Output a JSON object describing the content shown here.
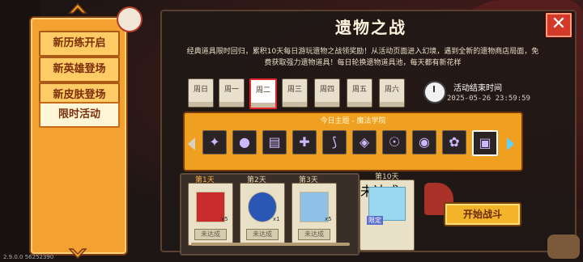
{
  "sidebar": {
    "items": [
      {
        "label": "新历练开启"
      },
      {
        "label": "新英雄登场"
      },
      {
        "label": "新皮肤登场"
      },
      {
        "label": "限时活动"
      }
    ]
  },
  "panel": {
    "title": "遗物之战",
    "description": "经典道具限时回归，累积10天每日游玩遗物之战领奖励！从活动页面进入幻境，遇到全新的遗物商店局面，免费获取强力遗物道具！每日轮换遗物道具池，每天都有新花样",
    "close_label": "✕"
  },
  "days": [
    "周日",
    "周一",
    "周二",
    "周三",
    "周四",
    "周五",
    "周六"
  ],
  "selected_day": 2,
  "timer": {
    "label": "活动结束时间",
    "date": "2025-05-26 23:59:59"
  },
  "theme": {
    "label": "今日主题 - 魔法学院",
    "relic_icons": [
      "sparkle-relic",
      "orb-relic",
      "book-relic",
      "cross-relic",
      "blade-relic",
      "jar-relic",
      "chalice-relic",
      "bomb-relic",
      "ring-relic",
      "chest-relic"
    ]
  },
  "rewards": [
    {
      "day": "第1天",
      "status": "未达成",
      "count": "x5"
    },
    {
      "day": "第2天",
      "status": "未达成",
      "count": "x1"
    },
    {
      "day": "第3天",
      "status": "未达成",
      "count": "x5"
    }
  ],
  "final_reward": {
    "day": "第10天",
    "status": "未达成",
    "tag": "限定"
  },
  "start_button": "开始战斗",
  "version": "2.9.0.0 56252390"
}
